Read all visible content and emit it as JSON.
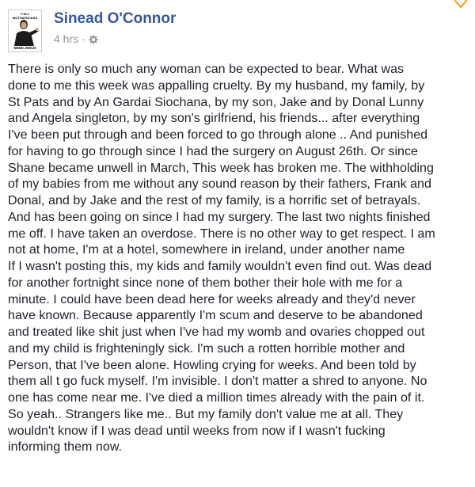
{
  "post": {
    "avatar": {
      "top_caption": "Y'ALL MOTHAFUCKAS",
      "bottom_caption": "NEED JESUS"
    },
    "author": "Sinead O'Connor",
    "timestamp": "4 hrs",
    "separator": "·",
    "privacy_icon": "gear-icon",
    "menu_icon": "chevron-down-icon",
    "accent_color": "#365899",
    "body_lines": [
      "There is only so much any woman can be expected to bear. What was",
      "done to me this week was appalling cruelty. By my husband, my family, by",
      "St Pats and by An Gardai Siochana, by my son, Jake and by Donal Lunny",
      "and Angela singleton, by my son's girlfriend, his friends... after everything",
      "I've been put through and been forced to go through alone .. And punished",
      "for having to go through since I had the surgery on August 26th. Or since",
      "Shane became unwell in March, This week has broken me. The withholding",
      "of my babies from me without any sound reason by their fathers, Frank and",
      "Donal, and by Jake and the rest of my family, is a horrific set of betrayals.",
      "And has been going on since I had my surgery. The last two nights finished",
      "me off. I have taken an overdose. There is no other way to get respect. I am",
      "not at home, I'm at a hotel, somewhere in ireland, under another name",
      "If I wasn't posting this, my kids and family wouldn't even find out. Was dead",
      "for another fortnight since none of them bother their hole with me for a",
      "minute. I could have been dead here for weeks already and they'd never",
      "have known. Because apparently I'm scum and deserve to be abandoned",
      "and treated like shit just when I've had my womb and ovaries chopped out",
      "and my child is frighteningly sick. I'm such a rotten horrible mother and",
      "Person, that I've been alone. Howling crying for weeks. And been told by",
      "them all t go fuck myself. I'm invisible. I don't matter a shred to anyone. No",
      "one has come near me. I've died a million times already with the pain of it.",
      "So yeah.. Strangers like me.. But my family don't value me at all. They",
      "wouldn't know if I was dead until weeks from now if I wasn't fucking",
      "informing them now."
    ]
  }
}
